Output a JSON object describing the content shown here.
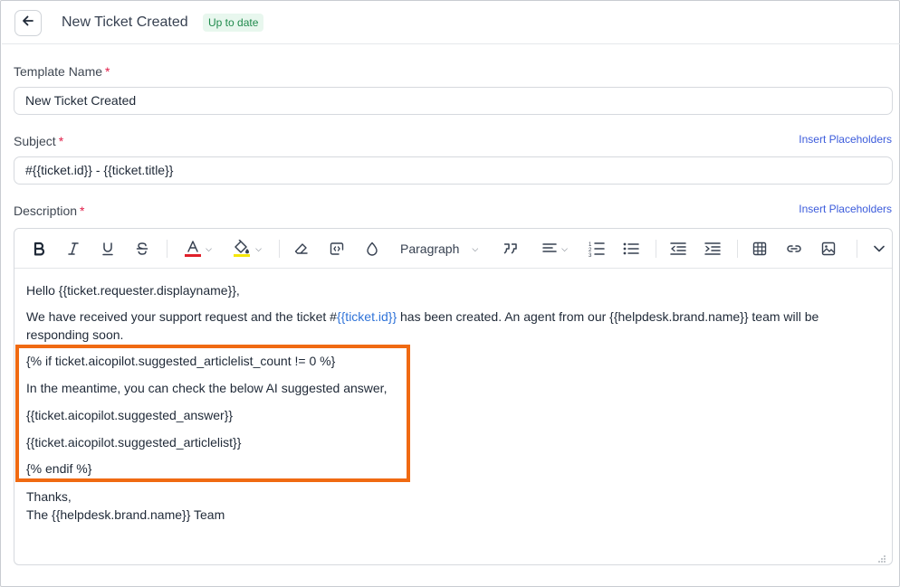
{
  "header": {
    "title": "New Ticket Created",
    "status": "Up to date"
  },
  "form": {
    "template_name": {
      "label": "Template Name",
      "required_mark": "*",
      "value": "New Ticket Created"
    },
    "subject": {
      "label": "Subject",
      "required_mark": "*",
      "value": "#{{ticket.id}} - {{ticket.title}}",
      "insert_link": "Insert Placeholders"
    },
    "description": {
      "label": "Description",
      "required_mark": "*",
      "insert_link": "Insert Placeholders"
    }
  },
  "toolbar": {
    "paragraph": "Paragraph",
    "font_color": "#e0202a",
    "highlight_color": "#f5e60a",
    "buttons": [
      "bold-icon",
      "italic-icon",
      "underline-icon",
      "strikethrough-icon",
      "font-color-icon",
      "highlight-icon",
      "eraser-icon",
      "code-icon",
      "drop-icon",
      "blockquote-icon",
      "align-icon",
      "numbered-list-icon",
      "bulleted-list-icon",
      "outdent-icon",
      "indent-icon",
      "table-icon",
      "link-icon",
      "image-icon",
      "more-icon"
    ]
  },
  "content": {
    "greeting": "Hello {{ticket.requester.displayname}},",
    "body_before": "We have received your support request and the ticket #",
    "body_placeholder": "{{ticket.id}}",
    "body_after": " has been created. An agent from our {{helpdesk.brand.name}} team will be responding soon.",
    "if_line": "{% if ticket.aicopilot.suggested_articlelist_count != 0 %}",
    "meantime_line": "In the meantime, you can check the below AI suggested answer,",
    "answer_line": "{{ticket.aicopilot.suggested_answer}}",
    "articlelist_line": "{{ticket.aicopilot.suggested_articlelist}}",
    "endif_line": "{% endif %}",
    "thanks": "Thanks,",
    "signature": "The {{helpdesk.brand.name}} Team"
  },
  "colors": {
    "highlight_box": "#f06a12",
    "placeholder_link": "#2f73d8",
    "badge_bg": "#e8f7ee",
    "badge_text": "#1f8a4c"
  }
}
